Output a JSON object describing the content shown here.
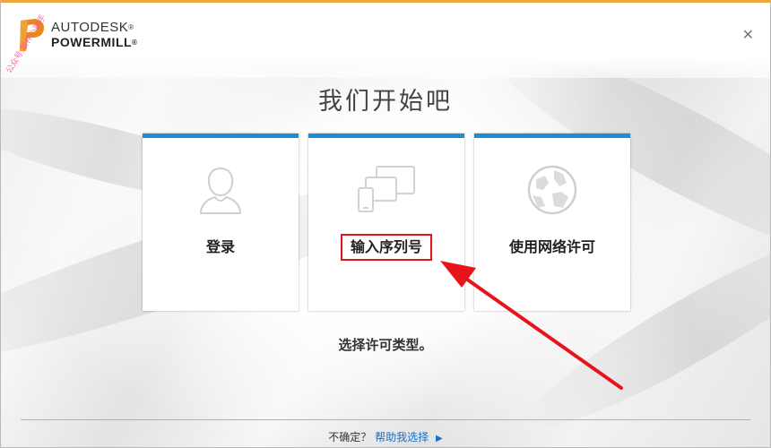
{
  "app": {
    "brand_line1": "AUTODESK",
    "brand_line2": "POWERMILL",
    "trademark": "®",
    "watermark": "公众号:软件小助手"
  },
  "header": {
    "close_icon": "close-icon"
  },
  "main": {
    "title": "我们开始吧",
    "options": [
      {
        "label": "登录",
        "icon": "user-icon"
      },
      {
        "label": "输入序列号",
        "icon": "devices-icon",
        "highlighted": true
      },
      {
        "label": "使用网络许可",
        "icon": "network-globe-icon"
      }
    ],
    "hint": "选择许可类型。"
  },
  "footer": {
    "question": "不确定？",
    "help_link": "帮助我选择",
    "link_arrow": "▶"
  },
  "colors": {
    "accent_top": "#f0a640",
    "card_bar": "#1f8dd6",
    "highlight": "#e0141b",
    "link": "#1a6fc4"
  }
}
